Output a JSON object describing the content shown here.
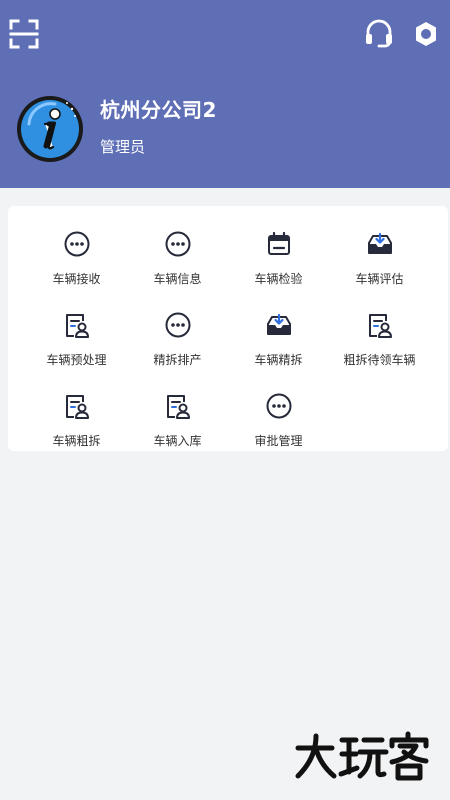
{
  "header": {
    "company_name": "杭州分公司2",
    "role": "管理员",
    "background_color": "#5f6fb6"
  },
  "toolbar": {
    "scan_icon": "scan-icon",
    "support_icon": "headset-icon",
    "settings_icon": "gear-icon"
  },
  "menu": {
    "items": [
      {
        "label": "车辆接收",
        "icon": "more-dots-icon"
      },
      {
        "label": "车辆信息",
        "icon": "more-dots-icon"
      },
      {
        "label": "车辆检验",
        "icon": "calendar-icon"
      },
      {
        "label": "车辆评估",
        "icon": "inbox-download-icon"
      },
      {
        "label": "车辆预处理",
        "icon": "user-document-icon"
      },
      {
        "label": "精拆排产",
        "icon": "more-dots-icon"
      },
      {
        "label": "车辆精拆",
        "icon": "inbox-download-icon"
      },
      {
        "label": "粗拆待领车辆",
        "icon": "user-document-icon"
      },
      {
        "label": "车辆粗拆",
        "icon": "user-document-icon"
      },
      {
        "label": "车辆入库",
        "icon": "user-document-icon"
      },
      {
        "label": "审批管理",
        "icon": "more-dots-icon"
      }
    ]
  },
  "watermark": {
    "text": "大玩客"
  }
}
